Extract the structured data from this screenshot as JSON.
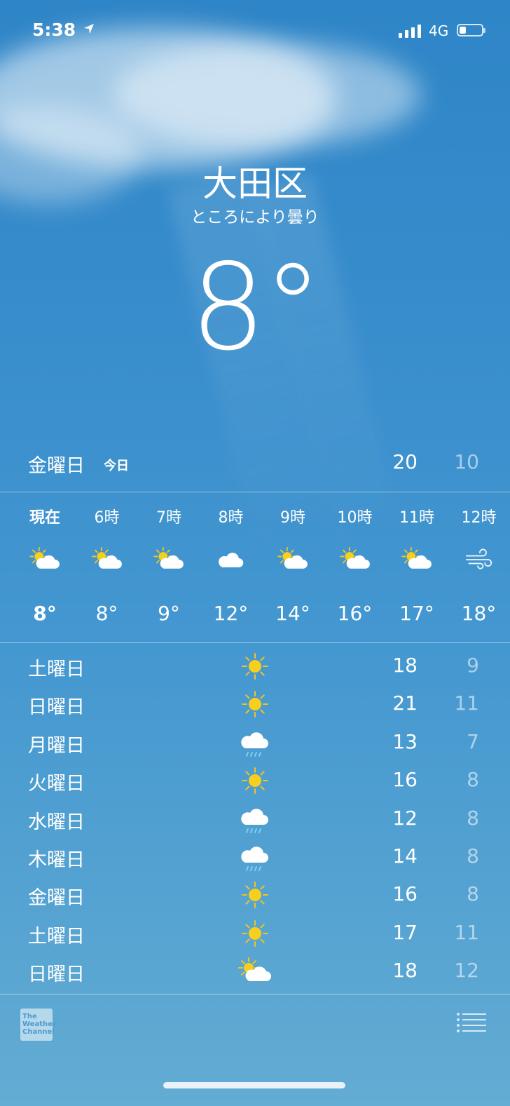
{
  "status_bar": {
    "time": "5:38",
    "network": "4G",
    "battery_level": 0.3,
    "signal_bars": 4
  },
  "location": {
    "city": "大田区",
    "condition": "ところにより曇り",
    "temperature": "8°"
  },
  "today": {
    "day": "金曜日",
    "tag": "今日",
    "high": "20",
    "low": "10"
  },
  "hourly": [
    {
      "label": "現在",
      "icon": "sun-cloud-icon",
      "temp": "8°",
      "bold": true
    },
    {
      "label": "6時",
      "icon": "sun-cloud-icon",
      "temp": "8°"
    },
    {
      "label": "7時",
      "icon": "sun-cloud-icon",
      "temp": "9°"
    },
    {
      "label": "8時",
      "icon": "cloud-icon",
      "temp": "12°"
    },
    {
      "label": "9時",
      "icon": "sun-cloud-icon",
      "temp": "14°"
    },
    {
      "label": "10時",
      "icon": "sun-cloud-icon",
      "temp": "16°"
    },
    {
      "label": "11時",
      "icon": "sun-cloud-icon",
      "temp": "17°"
    },
    {
      "label": "12時",
      "icon": "wind-icon",
      "temp": "18°"
    }
  ],
  "daily": [
    {
      "day": "土曜日",
      "icon": "sun-icon",
      "high": "18",
      "low": "9"
    },
    {
      "day": "日曜日",
      "icon": "sun-icon",
      "high": "21",
      "low": "11"
    },
    {
      "day": "月曜日",
      "icon": "rain-icon",
      "high": "13",
      "low": "7"
    },
    {
      "day": "火曜日",
      "icon": "sun-icon",
      "high": "16",
      "low": "8"
    },
    {
      "day": "水曜日",
      "icon": "rain-icon",
      "high": "12",
      "low": "8"
    },
    {
      "day": "木曜日",
      "icon": "rain-icon",
      "high": "14",
      "low": "8"
    },
    {
      "day": "金曜日",
      "icon": "sun-icon",
      "high": "16",
      "low": "8"
    },
    {
      "day": "土曜日",
      "icon": "sun-icon",
      "high": "17",
      "low": "11"
    },
    {
      "day": "日曜日",
      "icon": "sun-cloud-icon",
      "high": "18",
      "low": "12"
    }
  ],
  "footer": {
    "logo_text": "The Weather Channel",
    "list_icon": "list-icon"
  },
  "colors": {
    "sun": "#f7cf1d",
    "sun_ray": "#f3c322",
    "rain": "#7fd0f5",
    "cloud": "#ffffff"
  }
}
